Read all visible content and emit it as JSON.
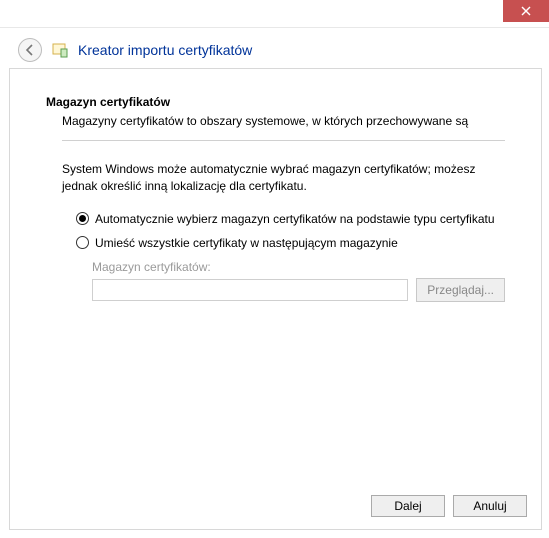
{
  "window": {
    "title": "Kreator importu certyfikatów"
  },
  "section": {
    "heading": "Magazyn certyfikatów",
    "description": "Magazyny certyfikatów to obszary systemowe, w których przechowywane są",
    "instruction": "System Windows może automatycznie wybrać magazyn certyfikatów; możesz jednak określić inną lokalizację dla certyfikatu."
  },
  "options": {
    "auto": "Automatycznie wybierz magazyn certyfikatów na podstawie typu certyfikatu",
    "manual": "Umieść wszystkie certyfikaty w następującym magazynie",
    "selected": "auto"
  },
  "store": {
    "label": "Magazyn certyfikatów:",
    "value": "",
    "browse": "Przeglądaj..."
  },
  "buttons": {
    "next": "Dalej",
    "cancel": "Anuluj"
  }
}
